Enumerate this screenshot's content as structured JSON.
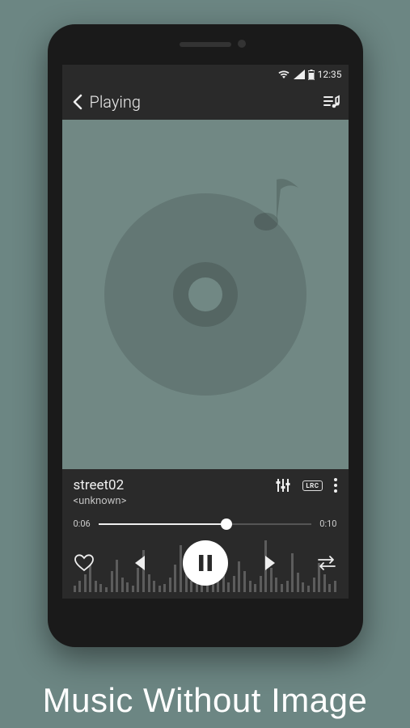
{
  "status_bar": {
    "time": "12:35"
  },
  "header": {
    "title": "Playing"
  },
  "track": {
    "title": "street02",
    "artist": "<unknown>",
    "lrc_label": "LRC"
  },
  "progress": {
    "elapsed": "0:06",
    "total": "0:10",
    "percent": 60
  },
  "caption": "Music Without Image",
  "eq_heights": [
    8,
    14,
    22,
    34,
    14,
    10,
    6,
    26,
    40,
    18,
    12,
    8,
    30,
    52,
    22,
    14,
    8,
    10,
    18,
    34,
    58,
    26,
    14,
    10,
    22,
    44,
    30,
    16,
    50,
    12,
    20,
    38,
    26,
    14,
    10,
    20,
    64,
    30,
    18,
    10,
    14,
    48,
    24,
    12,
    8,
    18,
    36,
    22,
    10,
    14
  ]
}
